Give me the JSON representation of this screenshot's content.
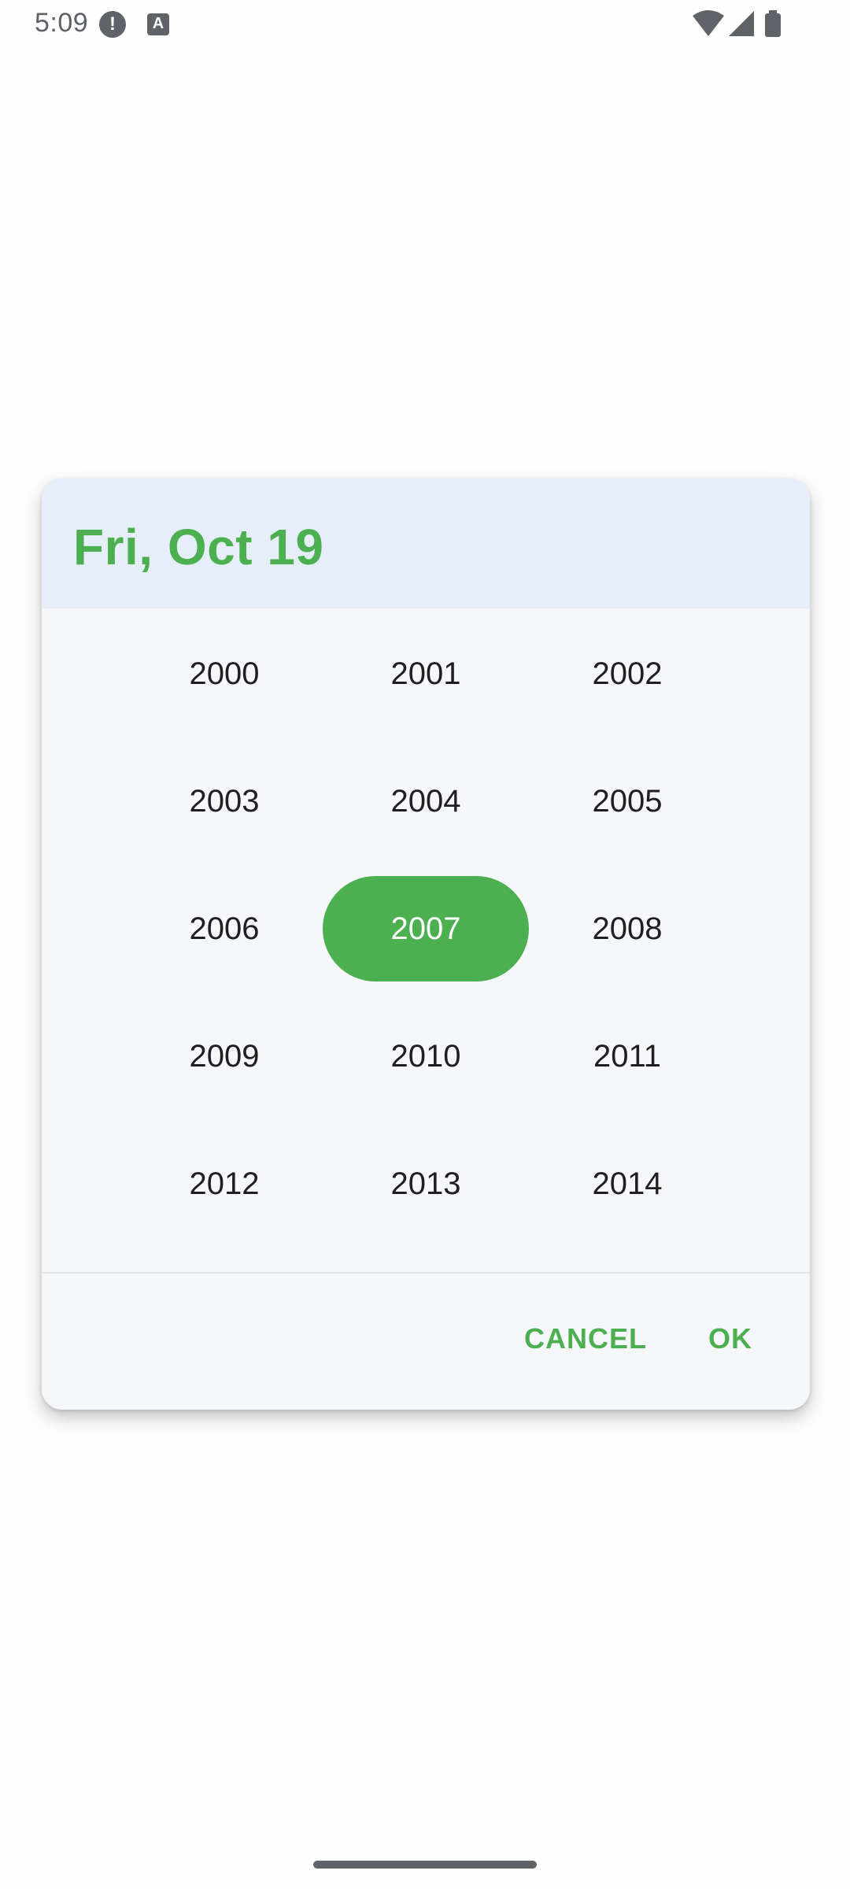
{
  "status_bar": {
    "time": "5:09",
    "alert_icon_glyph": "!",
    "keyboard_icon_glyph": "A",
    "icons": [
      "alert-icon",
      "keyboard-icon",
      "wifi-icon",
      "signal-icon",
      "battery-icon"
    ]
  },
  "dialog": {
    "header_date": "Fri, Oct 19",
    "years": [
      "2000",
      "2001",
      "2002",
      "2003",
      "2004",
      "2005",
      "2006",
      "2007",
      "2008",
      "2009",
      "2010",
      "2011",
      "2012",
      "2013",
      "2014"
    ],
    "selected_year": "2007",
    "cancel_label": "CANCEL",
    "ok_label": "OK"
  },
  "colors": {
    "accent": "#4caf50",
    "header_bg": "#e6eef9",
    "dialog_bg": "#f5f7fa",
    "text": "#1f1f1f"
  }
}
